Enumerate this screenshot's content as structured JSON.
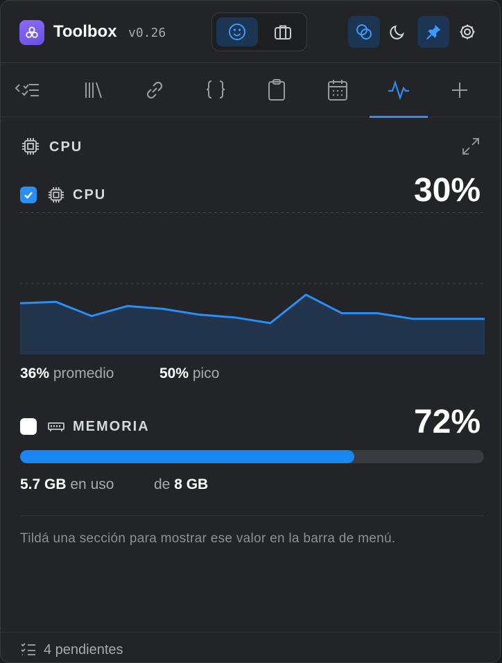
{
  "header": {
    "app_name": "Toolbox",
    "version": "v0.26",
    "modes": [
      {
        "icon": "smiley-icon",
        "active": true
      },
      {
        "icon": "briefcase-icon",
        "active": false
      }
    ],
    "actions": [
      {
        "icon": "overlap-circles-icon",
        "active": true
      },
      {
        "icon": "moon-icon",
        "active": false
      },
      {
        "icon": "pin-icon",
        "active": true
      },
      {
        "icon": "gear-icon",
        "active": false
      }
    ]
  },
  "tabs": [
    {
      "icon": "checklist-icon",
      "active": false
    },
    {
      "icon": "library-icon",
      "active": false
    },
    {
      "icon": "link-icon",
      "active": false
    },
    {
      "icon": "braces-icon",
      "active": false
    },
    {
      "icon": "clipboard-icon",
      "active": false
    },
    {
      "icon": "calendar-icon",
      "active": false
    },
    {
      "icon": "pulse-icon",
      "active": true
    },
    {
      "icon": "plus-icon",
      "active": false
    }
  ],
  "cpu_section": {
    "title": "CPU",
    "row_label": "CPU",
    "checked": true,
    "value": "30%",
    "avg_value": "36%",
    "avg_label": "promedio",
    "peak_value": "50%",
    "peak_label": "pico",
    "history": [
      36,
      37,
      27,
      34,
      32,
      28,
      26,
      22,
      42,
      29,
      29,
      25,
      25,
      25
    ]
  },
  "memory": {
    "label": "MEMORIA",
    "checked": false,
    "value": "72%",
    "fraction": 0.72,
    "used_value": "5.7 GB",
    "used_label": "en uso",
    "total_prefix": "de",
    "total_value": "8 GB"
  },
  "hint": "Tildá una sección para mostrar ese valor en la barra de menú.",
  "footer": {
    "pending": "4 pendientes"
  },
  "colors": {
    "accent": "#2a8ef5",
    "background": "#232428",
    "chart_fill": "#22354d"
  }
}
